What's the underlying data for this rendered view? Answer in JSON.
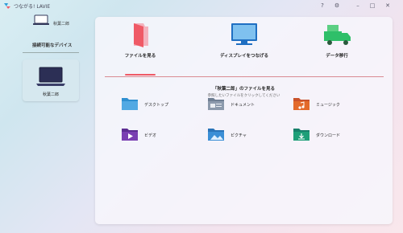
{
  "app": {
    "title": "つながる! LAVIE",
    "help_icon": "?",
    "settings_icon": "⚙",
    "minimize_icon": "–",
    "maximize_icon": "□",
    "close_icon": "✕"
  },
  "sidebar": {
    "this_pc_label": "秋葉二郎",
    "devices_title": "接続可能なデバイス",
    "devices": [
      {
        "label": "秋葉二郎",
        "selected": true
      }
    ]
  },
  "tabs": [
    {
      "label": "ファイルを見る",
      "icon": "folder-open-icon",
      "active": true
    },
    {
      "label": "ディスプレイをつなげる",
      "icon": "monitor-icon",
      "active": false
    },
    {
      "label": "データ移行",
      "icon": "truck-icon",
      "active": false
    }
  ],
  "content": {
    "title": "「秋葉二郎」のファイルを見る",
    "subtitle": "参照したいファイルをクリックしてください",
    "folders": [
      {
        "label": "デスクトップ",
        "icon": "desktop-folder-icon"
      },
      {
        "label": "ドキュメント",
        "icon": "documents-folder-icon"
      },
      {
        "label": "ミュージック",
        "icon": "music-folder-icon"
      },
      {
        "label": "ビデオ",
        "icon": "videos-folder-icon"
      },
      {
        "label": "ピクチャ",
        "icon": "pictures-folder-icon"
      },
      {
        "label": "ダウンロード",
        "icon": "downloads-folder-icon"
      }
    ]
  },
  "colors": {
    "accent": "#ef5a66",
    "folder_desktop": "#2f8fd0",
    "folder_documents": "#6f7f93",
    "folder_music": "#e36a2a",
    "folder_videos": "#7a3fb2",
    "folder_pictures": "#3b8fd6",
    "folder_downloads": "#1e9f78"
  }
}
